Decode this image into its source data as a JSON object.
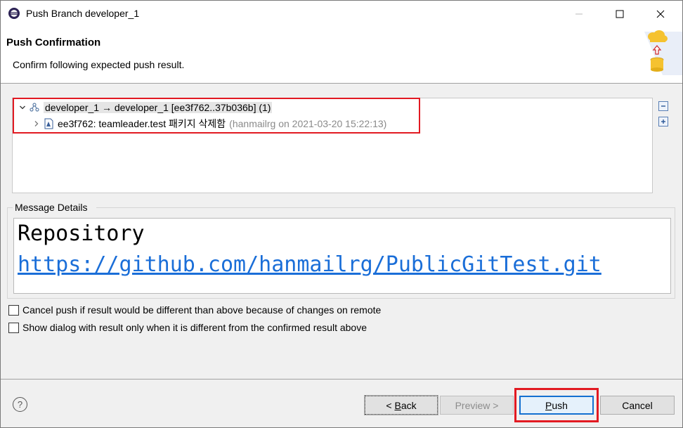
{
  "window": {
    "title": "Push Branch developer_1",
    "minimize_icon": "minimize-icon",
    "maximize_icon": "maximize-icon",
    "close_icon": "close-icon"
  },
  "header": {
    "title": "Push Confirmation",
    "description": "Confirm following expected push result.",
    "icon": "push-to-cloud-icon"
  },
  "tree": {
    "rows": [
      {
        "expanded": true,
        "icon": "branch-push-icon",
        "label": "developer_1 → developer_1 [ee3f762..37b036b] (1)",
        "detail": ""
      },
      {
        "expanded": false,
        "icon": "commit-icon",
        "label": "ee3f762: teamleader.test 패키지 삭제함",
        "detail": "(hanmailrg on 2021-03-20 15:22:13)"
      }
    ],
    "collapse_all_icon": "collapse-all-icon",
    "expand_all_icon": "expand-all-icon"
  },
  "message_details": {
    "label": "Message Details",
    "line1": "Repository",
    "line2": "https://github.com/hanmailrg/PublicGitTest.git"
  },
  "options": [
    {
      "label": "Cancel push if result would be different than above because of changes on remote",
      "checked": false
    },
    {
      "label": "Show dialog with result only when it is different from the confirmed result above",
      "checked": false
    }
  ],
  "footer": {
    "help_icon": "help-icon",
    "back_label_prefix": "< ",
    "back_label_mnemonic": "B",
    "back_label_rest": "ack",
    "preview_label": "Preview >",
    "push_label_mnemonic": "P",
    "push_label_rest": "ush",
    "cancel_label": "Cancel"
  },
  "colors": {
    "highlight_red": "#e21a22",
    "link_blue": "#1a6ed8",
    "default_button_border": "#1470d0"
  }
}
